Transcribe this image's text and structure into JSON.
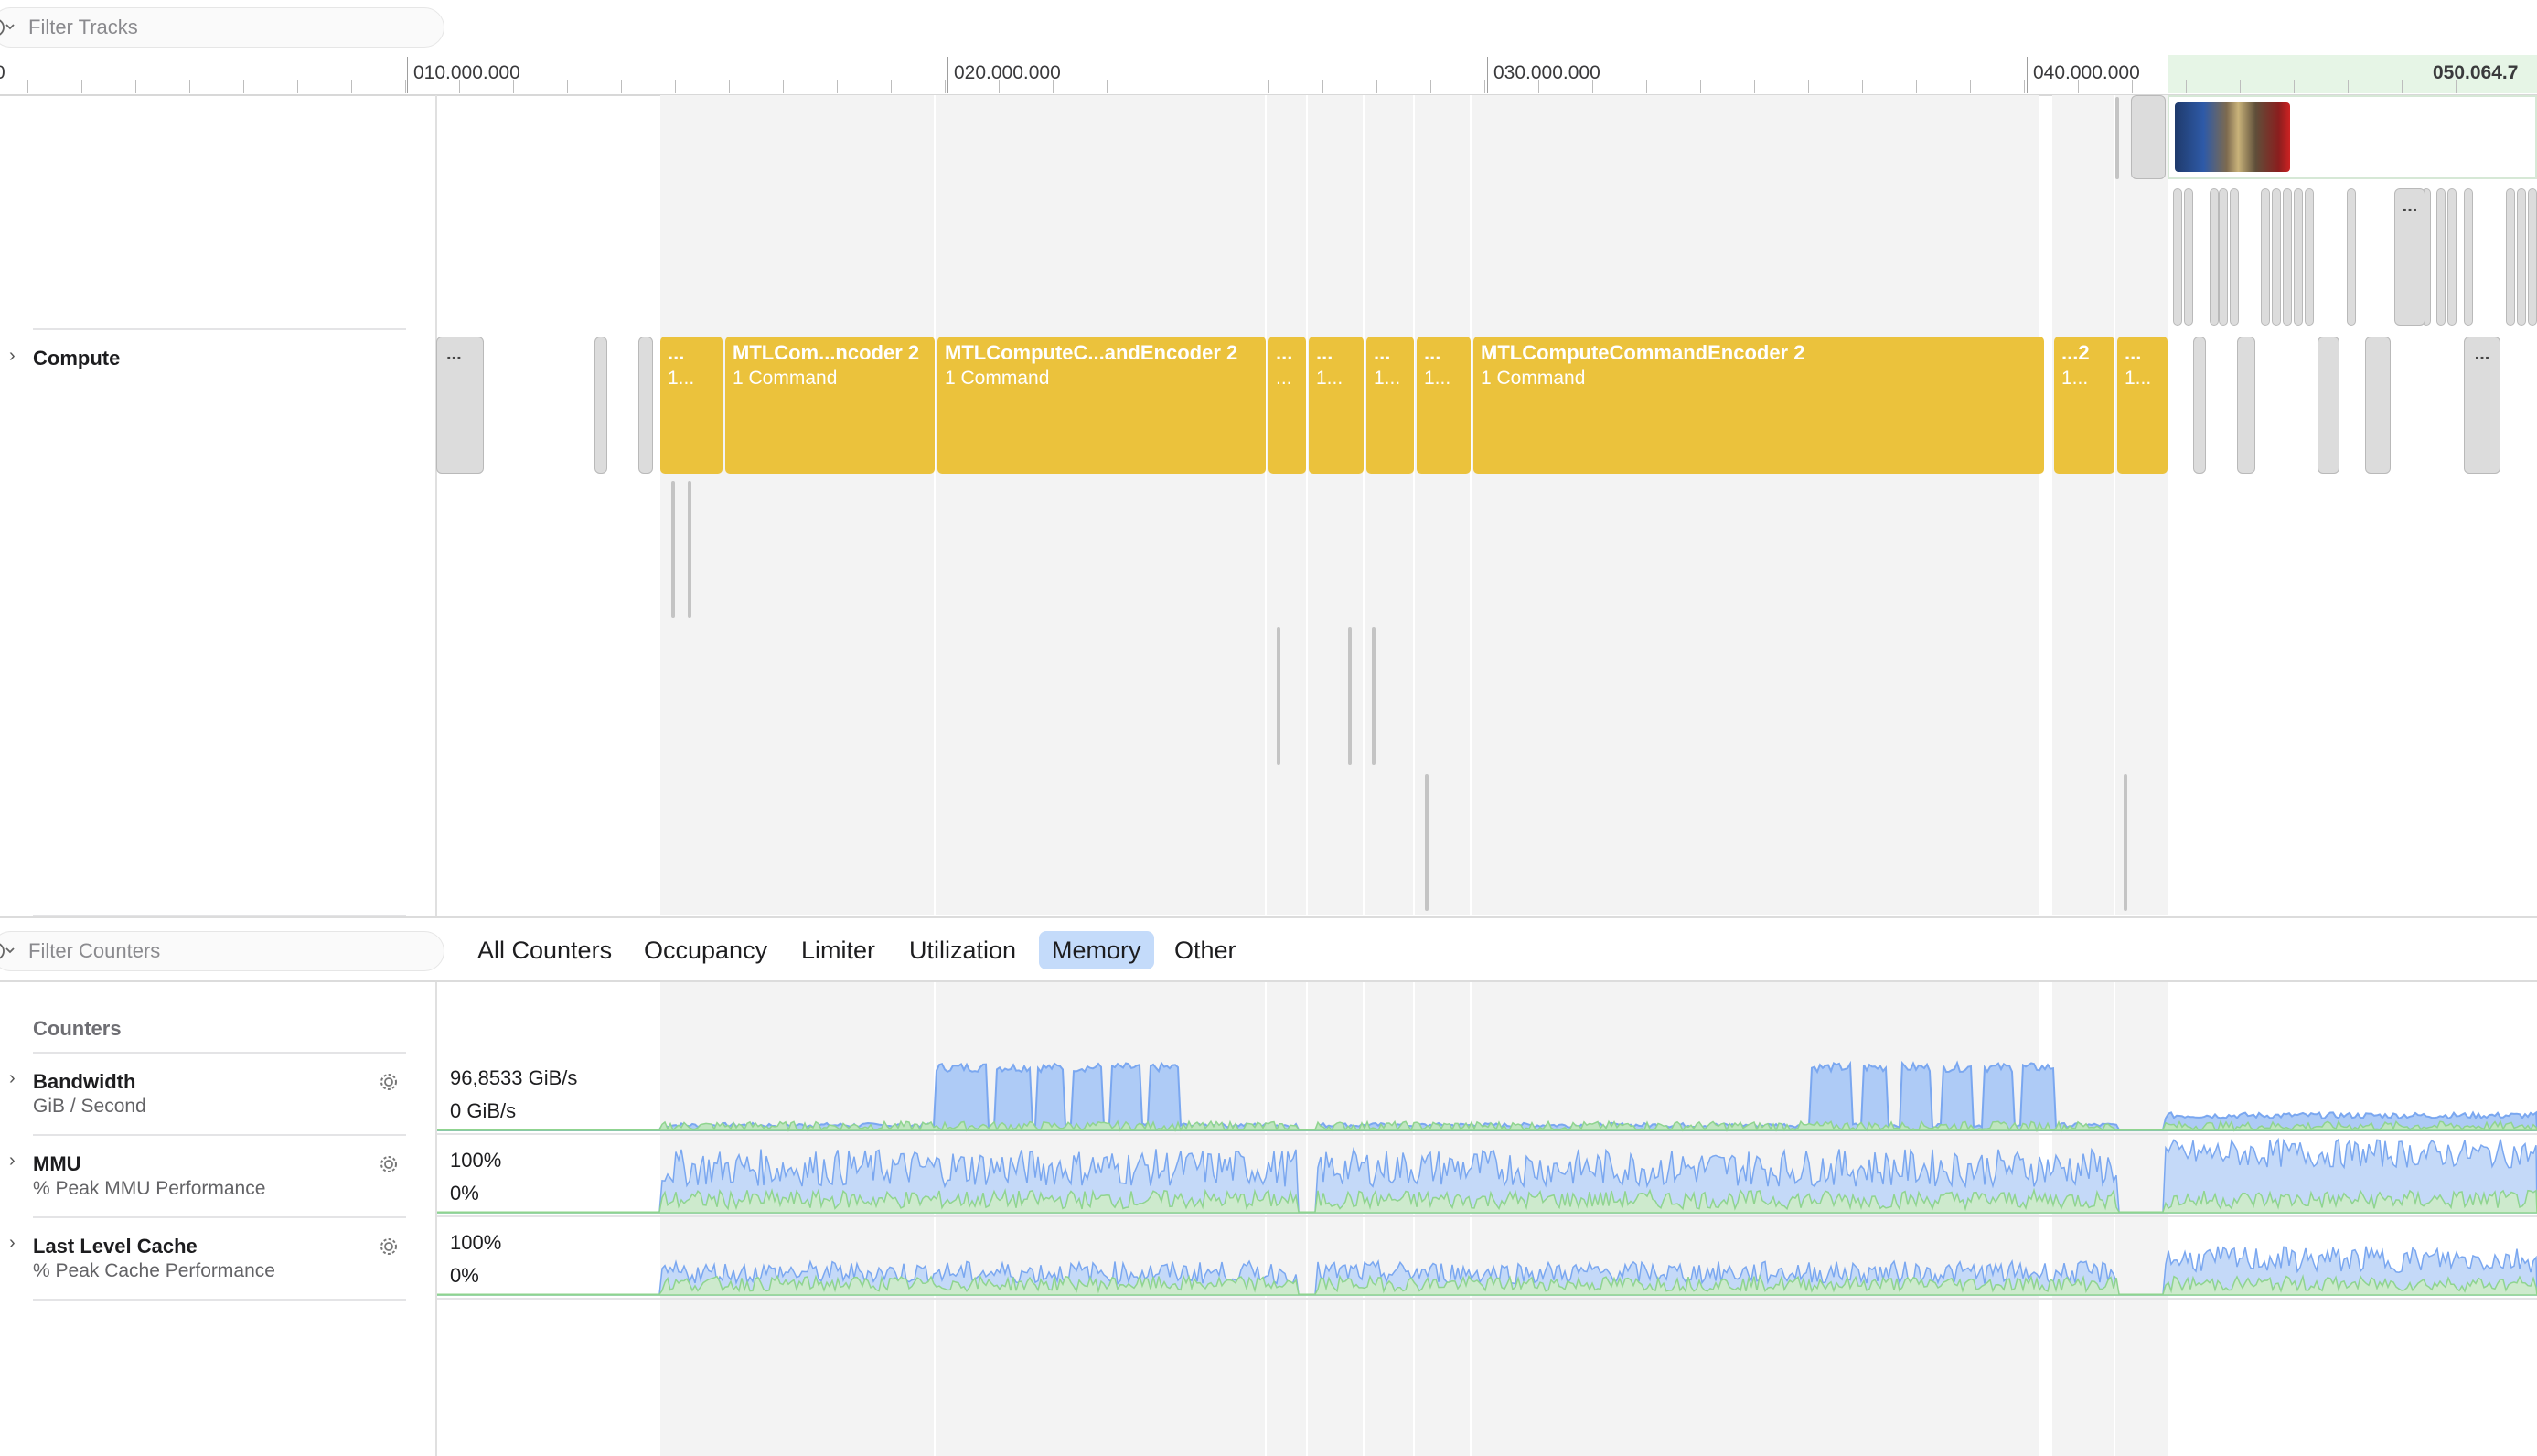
{
  "filter_tracks": {
    "placeholder": "Filter Tracks"
  },
  "ruler": {
    "origin_label": "0",
    "labels": [
      "010.000.000",
      "020.000.000",
      "030.000.000",
      "040.000.000",
      "050.064.7"
    ]
  },
  "tracks": [
    {
      "name": "Compute"
    }
  ],
  "encoders": [
    {
      "title": "...",
      "sub": "1..."
    },
    {
      "title": "MTLCom...ncoder 2",
      "sub": "1 Command"
    },
    {
      "title": "MTLComputeC...andEncoder 2",
      "sub": "1 Command"
    },
    {
      "title": "...",
      "sub": "..."
    },
    {
      "title": "...",
      "sub": "1..."
    },
    {
      "title": "...",
      "sub": "1..."
    },
    {
      "title": "...",
      "sub": "1..."
    },
    {
      "title": "MTLComputeCommandEncoder 2",
      "sub": "1 Command"
    },
    {
      "title": "...2",
      "sub": "1..."
    },
    {
      "title": "...",
      "sub": "1..."
    }
  ],
  "gray_marker": "...",
  "filter_counters": {
    "placeholder": "Filter Counters"
  },
  "tabs": [
    "All Counters",
    "Occupancy",
    "Limiter",
    "Utilization",
    "Memory",
    "Other"
  ],
  "active_tab": "Memory",
  "counters_header": "Counters",
  "counters": [
    {
      "name": "Bandwidth",
      "unit": "GiB / Second",
      "max": "96,8533 GiB/s",
      "min": "0 GiB/s"
    },
    {
      "name": "MMU",
      "unit": "% Peak MMU Performance",
      "max": "100%",
      "min": "0%"
    },
    {
      "name": "Last Level Cache",
      "unit": "% Peak Cache Performance",
      "max": "100%",
      "min": "0%"
    }
  ],
  "colors": {
    "encoder": "#ebc23c",
    "active_tab": "#c4dbfa",
    "series_blue": "#7aa7f0",
    "series_green": "#8fd48f",
    "selection": "#e6f5e6"
  },
  "icons": [
    "filter-icon",
    "chevron-right-icon",
    "gear-icon",
    "thumbnail-image"
  ]
}
